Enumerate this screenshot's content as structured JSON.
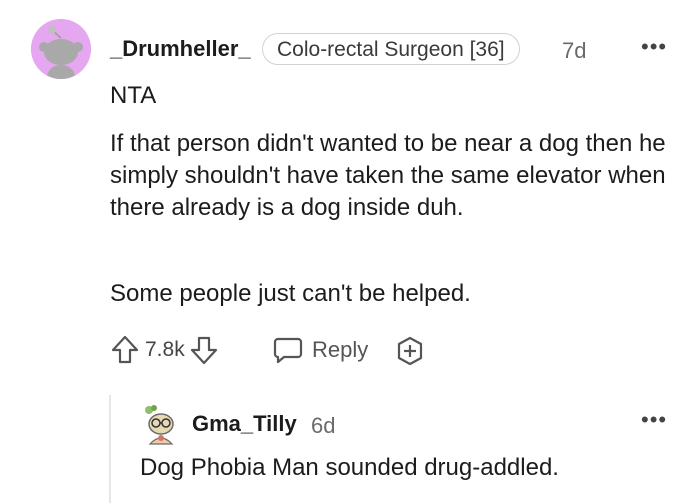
{
  "comment": {
    "username": "_Drumheller_",
    "flair": "Colo-rectal Surgeon [36]",
    "age": "7d",
    "more_label": "•••",
    "verdict": "NTA",
    "paragraphs": [
      "If that person didn't wanted to be near a dog then he simply shouldn't have taken the same elevator when there already is a dog inside duh.",
      "Some people just can't be helped."
    ],
    "vote_count": "7.8k",
    "reply_label": "Reply",
    "icons": {
      "avatar": "snoo-avatar-icon",
      "upvote": "arrow-up-icon",
      "downvote": "arrow-down-icon",
      "reply": "speech-bubble-icon",
      "award": "award-plus-icon",
      "more": "more-dots-icon"
    },
    "colors": {
      "avatar_bg": "#e4a7f0"
    }
  },
  "reply": {
    "username": "Gma_Tilly",
    "age": "6d",
    "more_label": "•••",
    "text": "Dog Phobia Man sounded drug-addled."
  }
}
